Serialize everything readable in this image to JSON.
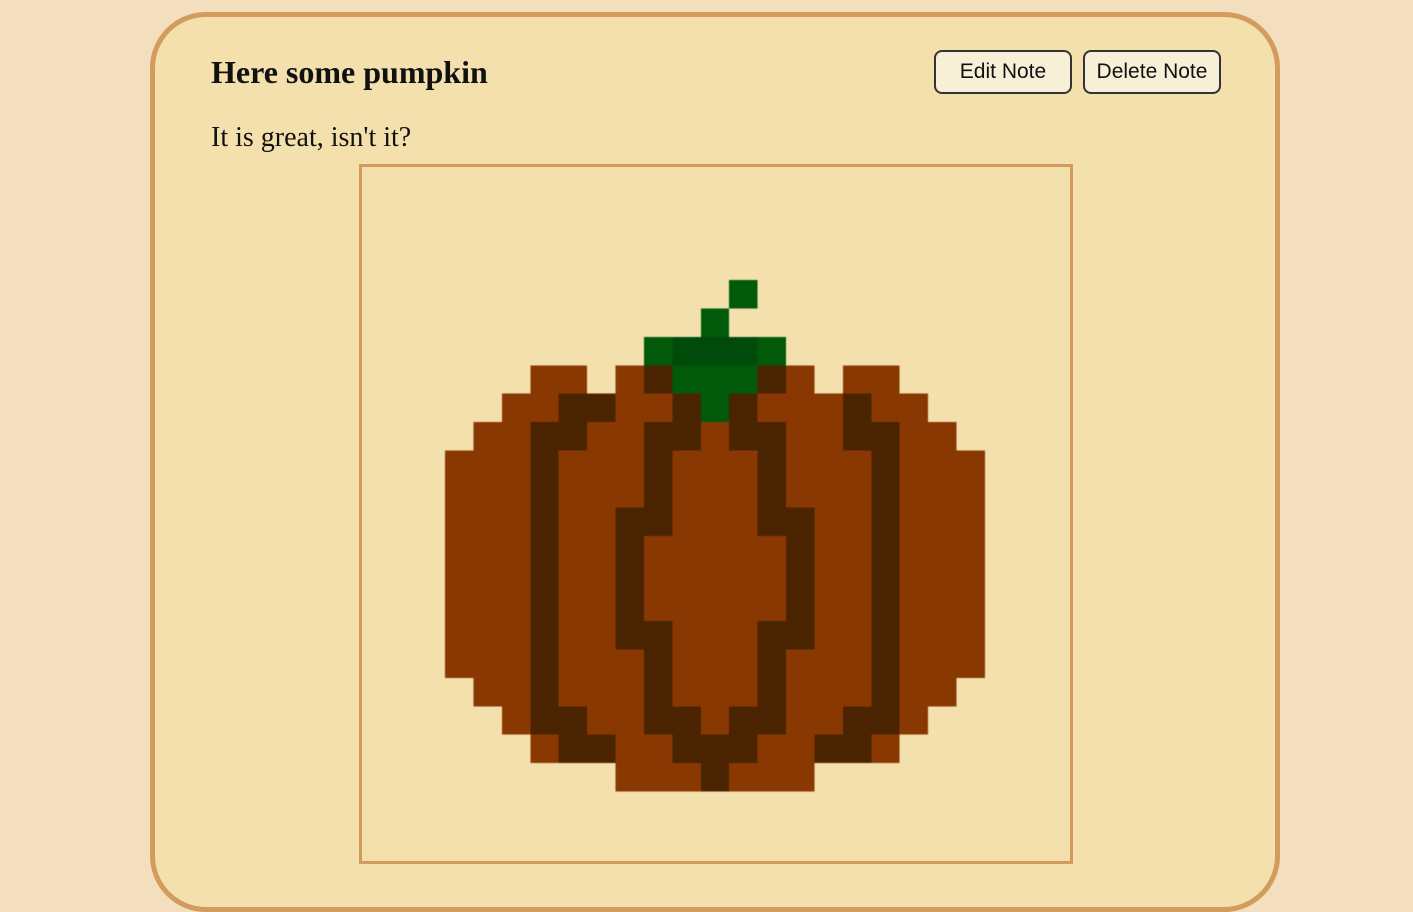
{
  "note": {
    "title": "Here some pumpkin",
    "body": "It is great, isn't it?",
    "edit_label": "Edit Note",
    "delete_label": "Delete Note"
  },
  "image": {
    "subject": "pixel-art pumpkin",
    "colors": {
      "stem": "#005a0a",
      "stem_dark": "#004b09",
      "body": "#8a3802",
      "outline": "#4a2400",
      "background": "#f3e0ad"
    }
  }
}
